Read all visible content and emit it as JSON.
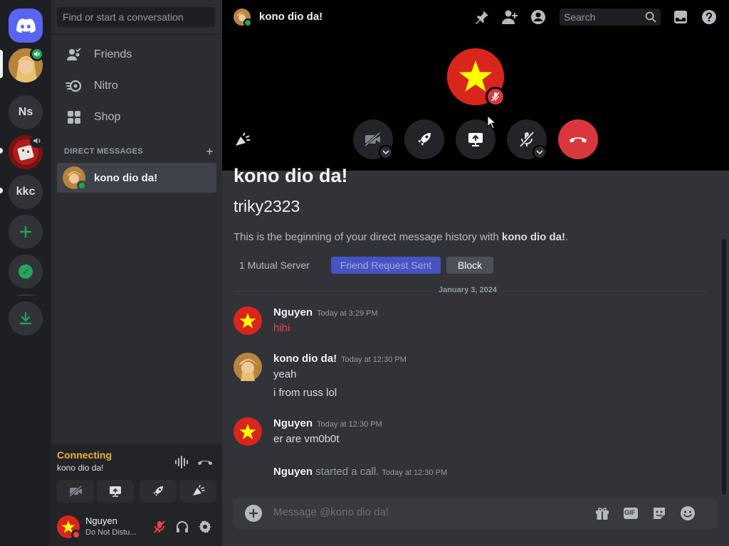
{
  "servers": {
    "home_icon": "discord-logo-icon",
    "items": [
      {
        "label": "",
        "type": "avatar"
      },
      {
        "label": "Ns"
      },
      {
        "label": "",
        "type": "avatar"
      },
      {
        "label": "kkc"
      }
    ],
    "add_icon": "plus-icon",
    "explore_icon": "compass-icon",
    "download_icon": "download-icon"
  },
  "sidebar": {
    "search_placeholder": "Find or start a conversation",
    "nav": [
      {
        "label": "Friends",
        "icon": "friends-icon"
      },
      {
        "label": "Nitro",
        "icon": "nitro-icon"
      },
      {
        "label": "Shop",
        "icon": "shop-icon"
      }
    ],
    "dm_header": "DIRECT MESSAGES",
    "dm_add": "+",
    "dms": [
      {
        "name": "kono dio da!"
      }
    ]
  },
  "voice": {
    "status": "Connecting",
    "channel": "kono dio da!"
  },
  "user": {
    "name": "Nguyen",
    "status": "Do Not Distu..."
  },
  "header": {
    "title": "kono dio da!",
    "search_placeholder": "Search"
  },
  "chat": {
    "title": "kono dio da!",
    "username": "triky2323",
    "intro_prefix": "This is the beginning of your direct message history with ",
    "intro_name": "kono dio da!",
    "intro_suffix": ".",
    "mutual": "1 Mutual Server",
    "friend_request": "Friend Request Sent",
    "block": "Block",
    "date_divider": "January 3, 2024",
    "messages": [
      {
        "author": "Nguyen",
        "time": "Today at 3:29 PM",
        "lines": [
          "hihi"
        ]
      },
      {
        "author": "kono dio da!",
        "time": "Today at 12:30 PM",
        "lines": [
          "yeah",
          "i from russ lol"
        ]
      },
      {
        "author": "Nguyen",
        "time": "Today at 12:30 PM",
        "lines": [
          "er are vm0b0t"
        ]
      }
    ],
    "system": {
      "author": "Nguyen",
      "text": " started a call.",
      "time": "Today at 12:30 PM"
    }
  },
  "composer": {
    "placeholder": "Message @kono dio da!",
    "gif": "GIF"
  },
  "colors": {
    "brand": "#5865f2",
    "online": "#23a55a",
    "danger": "#da373c",
    "connecting": "#f0b232",
    "vietnam_red": "#da251d",
    "vietnam_star": "#ffff00"
  }
}
